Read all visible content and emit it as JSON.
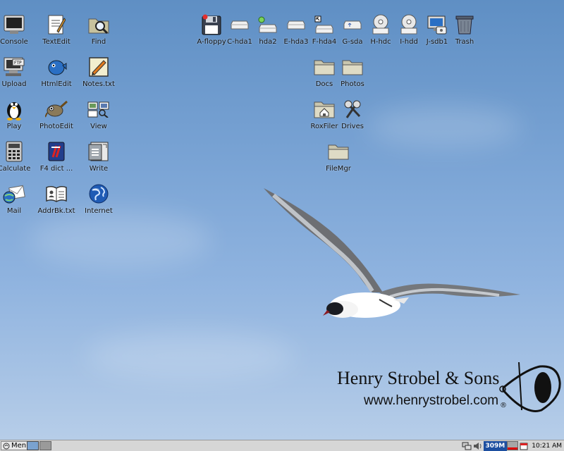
{
  "desktop": {
    "left_icons": [
      {
        "label": "Console",
        "icon": "console-icon"
      },
      {
        "label": "TextEdit",
        "icon": "text-edit-icon"
      },
      {
        "label": "Find",
        "icon": "find-icon"
      },
      {
        "label": "Upload",
        "icon": "upload-icon"
      },
      {
        "label": "HtmlEdit",
        "icon": "html-edit-icon"
      },
      {
        "label": "Notes.txt",
        "icon": "notes-icon"
      },
      {
        "label": "Play",
        "icon": "penguin-icon"
      },
      {
        "label": "PhotoEdit",
        "icon": "photo-edit-icon"
      },
      {
        "label": "View",
        "icon": "view-icon"
      },
      {
        "label": "Calculate",
        "icon": "calculator-icon"
      },
      {
        "label": "F4 dict ...",
        "icon": "dictionary-icon"
      },
      {
        "label": "Write",
        "icon": "write-icon"
      },
      {
        "label": "Mail",
        "icon": "mail-icon"
      },
      {
        "label": "AddrBk.txt",
        "icon": "address-book-icon"
      },
      {
        "label": "Internet",
        "icon": "globe-icon"
      }
    ],
    "drives": [
      {
        "label": "A-floppy",
        "icon": "floppy-icon"
      },
      {
        "label": "C-hda1",
        "icon": "drive-icon"
      },
      {
        "label": "hda2",
        "icon": "drive-mounted-icon"
      },
      {
        "label": "E-hda3",
        "icon": "drive-icon"
      },
      {
        "label": "F-hda4",
        "icon": "drive-icon"
      },
      {
        "label": "G-sda",
        "icon": "usb-drive-icon"
      },
      {
        "label": "H-hdc",
        "icon": "optical-drive-icon"
      },
      {
        "label": "I-hdd",
        "icon": "optical-drive-icon"
      },
      {
        "label": "J-sdb1",
        "icon": "card-reader-icon"
      },
      {
        "label": "Trash",
        "icon": "trash-icon"
      }
    ],
    "folders": [
      {
        "label": "Docs",
        "icon": "folder-icon"
      },
      {
        "label": "Photos",
        "icon": "folder-icon"
      },
      {
        "label": "RoxFiler",
        "icon": "home-folder-icon"
      },
      {
        "label": "Drives",
        "icon": "drives-icon"
      },
      {
        "label": "FileMgr",
        "icon": "folder-icon"
      }
    ]
  },
  "wallpaper": {
    "brand_name": "Henry Strobel & Sons",
    "brand_url": "www.henrystrobel.com",
    "registered": "®"
  },
  "taskbar": {
    "menu_label": "Menu",
    "memory": "309M",
    "clock": "10:21 AM"
  },
  "colors": {
    "sky_top": "#5f8fc4",
    "sky_bottom": "#b9cfe9",
    "taskbar": "#d6d6d6",
    "memory_bg": "#1d4fa0"
  }
}
